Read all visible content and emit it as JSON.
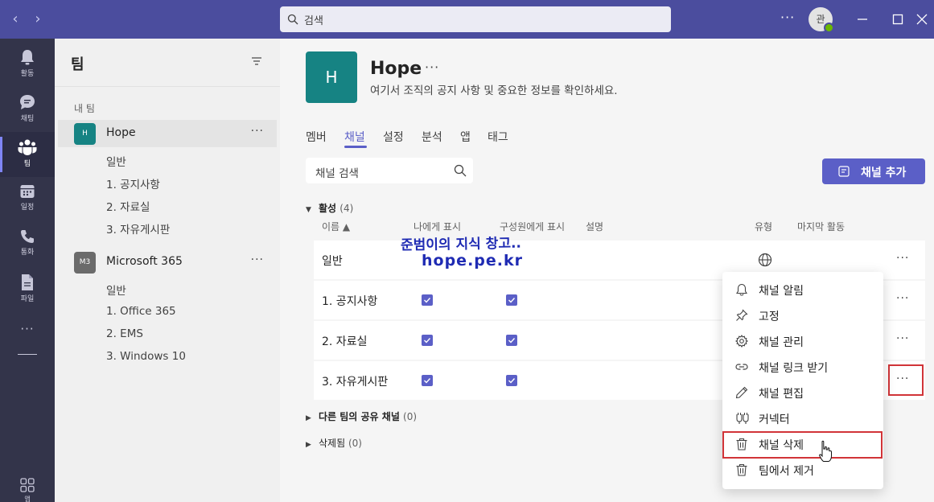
{
  "titlebar": {
    "search_placeholder": "검색",
    "avatar_initial": "관",
    "more_label": "···"
  },
  "rail": {
    "items": [
      {
        "label": "활동",
        "icon": "bell-icon"
      },
      {
        "label": "채팅",
        "icon": "chat-icon"
      },
      {
        "label": "팀",
        "icon": "teams-icon"
      },
      {
        "label": "일정",
        "icon": "calendar-icon"
      },
      {
        "label": "통화",
        "icon": "phone-icon"
      },
      {
        "label": "파일",
        "icon": "file-icon"
      }
    ],
    "more_label": "···",
    "apps_label": "앱"
  },
  "sidebar": {
    "title": "팀",
    "section_label": "내 팀",
    "teams": [
      {
        "initial": "H",
        "name": "Hope",
        "color": "#168383",
        "more": "···",
        "channels": [
          "일반",
          "1. 공지사항",
          "2. 자료실",
          "3. 자유게시판"
        ]
      },
      {
        "initial": "M3",
        "name": "Microsoft 365",
        "color": "#6b6b6b",
        "more": "···",
        "channels": [
          "일반",
          "1. Office 365",
          "2. EMS",
          "3. Windows 10"
        ]
      }
    ]
  },
  "main": {
    "hero_initial": "H",
    "team_name": "Hope",
    "team_more": "···",
    "description": "여기서 조직의 공지 사항 및 중요한 정보를 확인하세요.",
    "tabs": [
      "멤버",
      "채널",
      "설정",
      "분석",
      "앱",
      "태그"
    ],
    "active_tab": "채널",
    "channel_search_placeholder": "채널 검색",
    "add_channel_label": "채널 추가",
    "active_group": {
      "label": "활성",
      "count": "(4)"
    },
    "columns": [
      "이름 ▲",
      "나에게 표시",
      "구성원에게 표시",
      "설명",
      "유형",
      "마지막 활동"
    ],
    "channels": [
      {
        "name": "일반",
        "show_me": null,
        "show_members": null,
        "type_icon": "globe-icon",
        "more": "···"
      },
      {
        "name": "1. 공지사항",
        "show_me": true,
        "show_members": true,
        "more": "···"
      },
      {
        "name": "2. 자료실",
        "show_me": true,
        "show_members": true,
        "more": "···"
      },
      {
        "name": "3. 자유게시판",
        "show_me": true,
        "show_members": true,
        "more": "···"
      }
    ],
    "shared_group": {
      "label": "다른 팀의 공유 채널",
      "count": "(0)"
    },
    "deleted_group": {
      "label": "삭제됨",
      "count": "(0)"
    },
    "watermark_line1": "준범이의 지식 창고..",
    "watermark_line2": "hope.pe.kr"
  },
  "context_menu": {
    "items": [
      {
        "label": "채널 알림",
        "icon": "bell-icon"
      },
      {
        "label": "고정",
        "icon": "pin-icon"
      },
      {
        "label": "채널 관리",
        "icon": "gear-icon"
      },
      {
        "label": "채널 링크 받기",
        "icon": "link-icon"
      },
      {
        "label": "채널 편집",
        "icon": "pencil-icon"
      },
      {
        "label": "커넥터",
        "icon": "connector-icon"
      },
      {
        "label": "채널 삭제",
        "icon": "trash-icon"
      },
      {
        "label": "팀에서 제거",
        "icon": "trash-icon"
      }
    ]
  },
  "colors": {
    "titlebar": "#4b4d9e",
    "rail": "#33344a",
    "accent": "#5b5fc7",
    "highlight_box": "#d13438"
  }
}
